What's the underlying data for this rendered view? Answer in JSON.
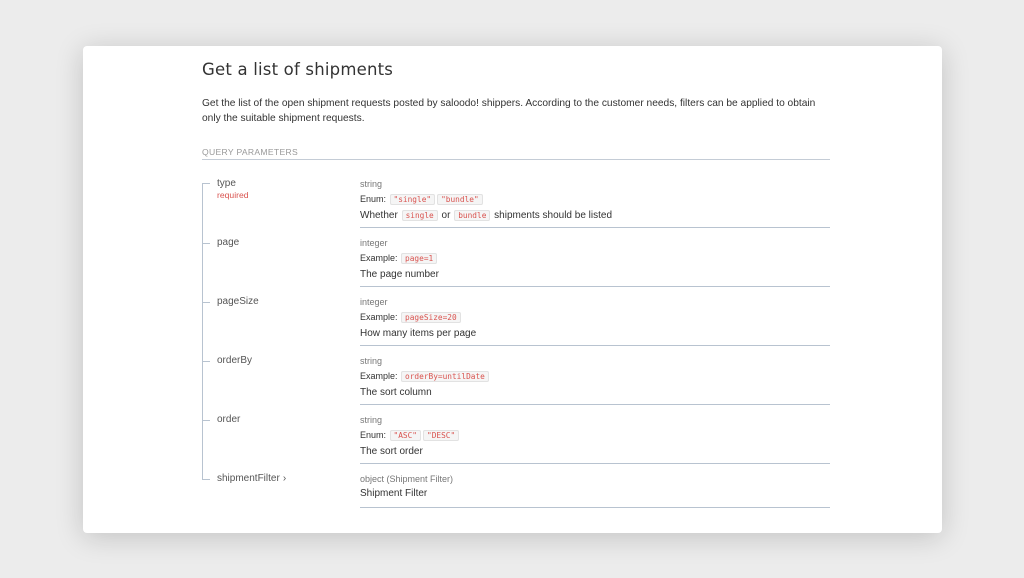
{
  "page": {
    "title": "Get a list of shipments",
    "description": "Get the list of the open shipment requests posted by saloodo! shippers. According to the customer needs, filters can be applied to obtain only the suitable shipment requests.",
    "section_label": "QUERY PARAMETERS"
  },
  "params": [
    {
      "name": "type",
      "required": "required",
      "type": "string",
      "line_label": "Enum:",
      "codes": [
        "\"single\"",
        "\"bundle\""
      ],
      "desc_prefix": "Whether",
      "desc_code1": "single",
      "desc_mid": "or",
      "desc_code2": "bundle",
      "desc_suffix": "shipments should be listed"
    },
    {
      "name": "page",
      "type": "integer",
      "line_label": "Example:",
      "code": "page=1",
      "desc": "The page number"
    },
    {
      "name": "pageSize",
      "type": "integer",
      "line_label": "Example:",
      "code": "pageSize=20",
      "desc": "How many items per page"
    },
    {
      "name": "orderBy",
      "type": "string",
      "line_label": "Example:",
      "code": "orderBy=untilDate",
      "desc": "The sort column"
    },
    {
      "name": "order",
      "type": "string",
      "line_label": "Enum:",
      "codes": [
        "\"ASC\"",
        "\"DESC\""
      ],
      "desc": "The sort order"
    },
    {
      "name": "shipmentFilter",
      "chevron": "›",
      "type": "object (Shipment Filter)",
      "desc": "Shipment Filter"
    }
  ],
  "icons": {
    "expand": "chevron-right-icon"
  }
}
